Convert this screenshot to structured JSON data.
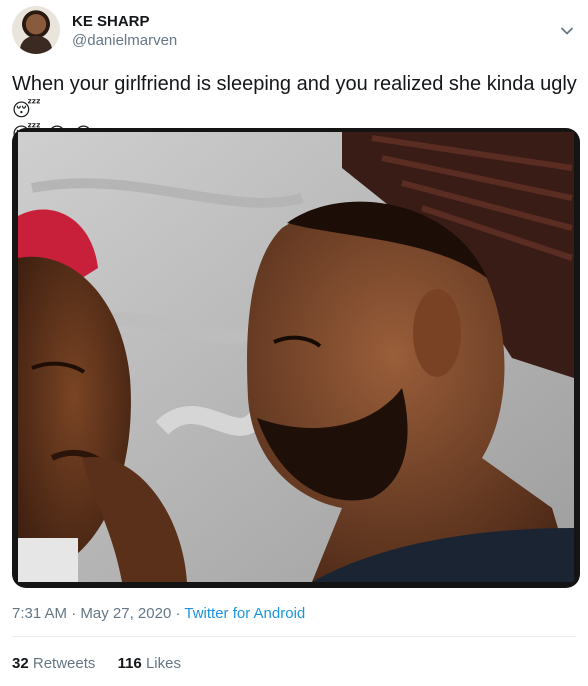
{
  "user": {
    "display_name": "KE SHARP",
    "handle": "@danielmarven"
  },
  "tweet": {
    "text": "When your girlfriend is sleeping and you realized she kinda ugly",
    "emojis": [
      "😴",
      "😴",
      "😂",
      "😂"
    ]
  },
  "meta": {
    "time": "7:31 AM",
    "separator": " · ",
    "date": "May 27, 2020",
    "source": "Twitter for Android"
  },
  "stats": {
    "retweets_count": "32",
    "retweets_label": "Retweets",
    "likes_count": "116",
    "likes_label": "Likes"
  },
  "icons": {
    "caret": "chevron-down-icon"
  },
  "colors": {
    "text": "#14171a",
    "secondary": "#657786",
    "link": "#1b95e0",
    "divider": "#e6ecf0"
  }
}
